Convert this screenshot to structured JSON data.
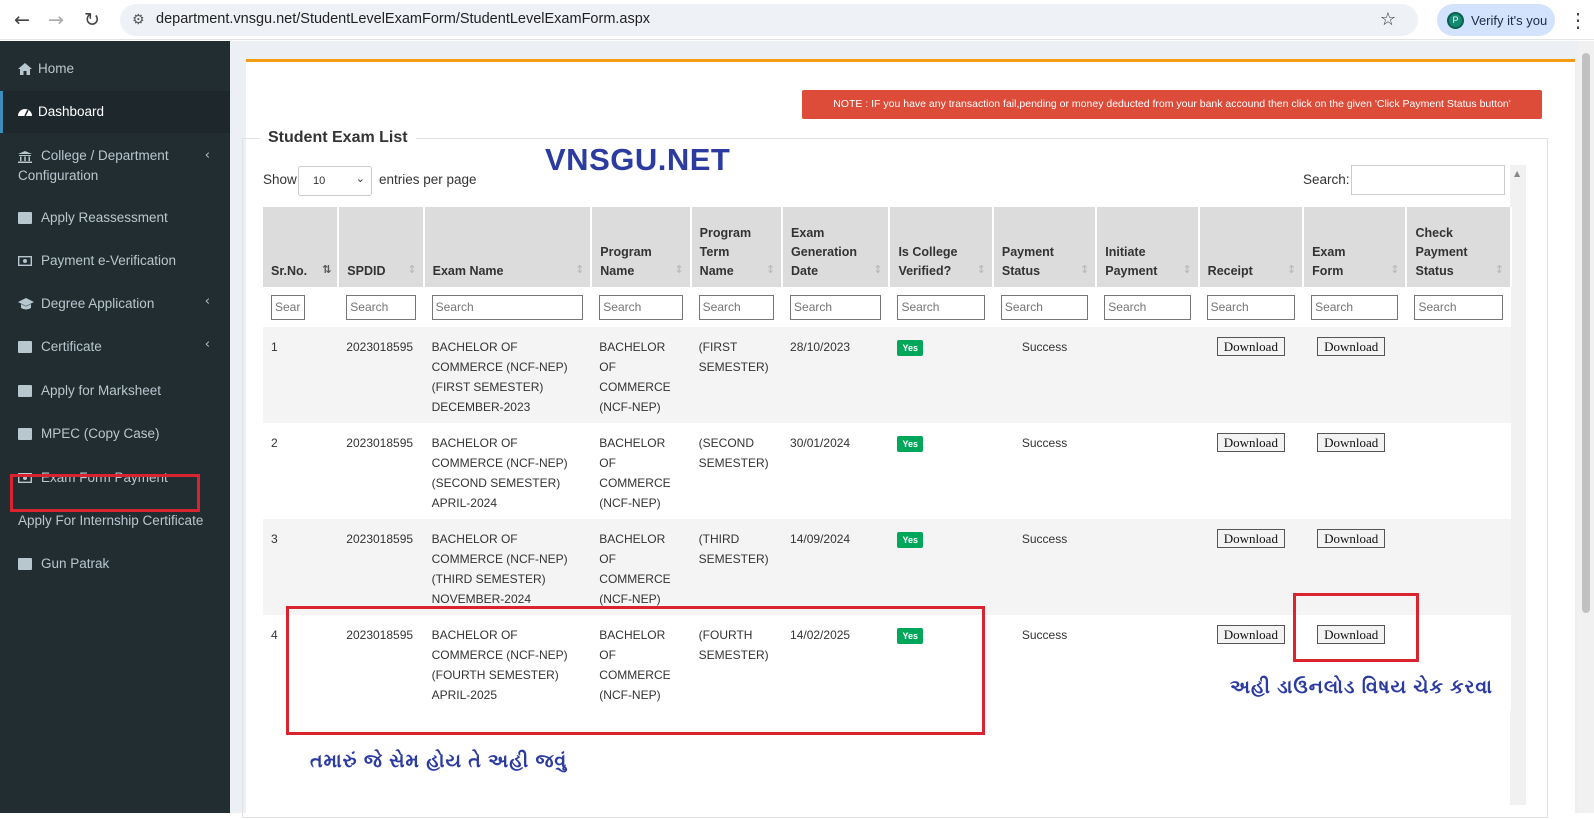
{
  "browser": {
    "url": "department.vnsgu.net/StudentLevelExamForm/StudentLevelExamForm.aspx",
    "profile_label": "Verify it's you",
    "profile_initial": "P"
  },
  "sidebar": {
    "items": [
      {
        "label": "Home",
        "icon": "home-icon"
      },
      {
        "label": "Dashboard",
        "icon": "dashboard-icon"
      },
      {
        "label": "College / Department",
        "label2": "Configuration",
        "icon": "institution-icon"
      },
      {
        "label": "Apply Reassessment",
        "icon": "book-icon"
      },
      {
        "label": "Payment e-Verification",
        "icon": "money-icon"
      },
      {
        "label": "Degree Application",
        "icon": "graduation-cap-icon"
      },
      {
        "label": "Certificate",
        "icon": "book-icon"
      },
      {
        "label": "Apply for Marksheet",
        "icon": "book-icon"
      },
      {
        "label": "MPEC (Copy Case)",
        "icon": "book-icon"
      },
      {
        "label": "Exam Form Payment",
        "icon": "money-icon"
      },
      {
        "label": "Apply For Internship Certificate",
        "icon": ""
      },
      {
        "label": "Gun Patrak",
        "icon": "book-icon"
      }
    ]
  },
  "note": "NOTE : IF you have any transaction fail,pending or money deducted from your bank accound then click on the given 'Click Payment Status button'",
  "section_title": "Student Exam List",
  "watermark": "VNSGU.NET",
  "table_controls": {
    "show_label": "Show",
    "entries_value": "10",
    "entries_label": "entries per page",
    "search_label": "Search:"
  },
  "columns": [
    {
      "l1": "",
      "l2": "",
      "l3": "Sr.No."
    },
    {
      "l1": "",
      "l2": "",
      "l3": "SPDID"
    },
    {
      "l1": "",
      "l2": "",
      "l3": "Exam Name"
    },
    {
      "l1": "",
      "l2": "Program",
      "l3": "Name"
    },
    {
      "l1": "Program",
      "l2": "Term",
      "l3": "Name"
    },
    {
      "l1": "Exam",
      "l2": "Generation",
      "l3": "Date"
    },
    {
      "l1": "",
      "l2": "Is College",
      "l3": "Verified?"
    },
    {
      "l1": "",
      "l2": "Payment",
      "l3": "Status"
    },
    {
      "l1": "",
      "l2": "Initiate",
      "l3": "Payment"
    },
    {
      "l1": "",
      "l2": "",
      "l3": "Receipt"
    },
    {
      "l1": "",
      "l2": "Exam",
      "l3": "Form"
    },
    {
      "l1": "Check",
      "l2": "Payment",
      "l3": "Status"
    }
  ],
  "filter_placeholders": [
    "Sear",
    "Search",
    "Search",
    "Search",
    "Search",
    "Search",
    "Search",
    "Search",
    "Search",
    "Search",
    "Search",
    "Search"
  ],
  "rows": [
    {
      "sr": "1",
      "spdid": "2023018595",
      "exam": [
        "BACHELOR OF",
        "COMMERCE (NCF-NEP)",
        "(FIRST SEMESTER)",
        "DECEMBER-2023"
      ],
      "program": [
        "BACHELOR OF",
        "COMMERCE",
        "(NCF-NEP)"
      ],
      "term": [
        "(FIRST",
        "SEMESTER)"
      ],
      "date": "28/10/2023",
      "verified": "Yes",
      "status": "Success",
      "receipt": "Download",
      "form": "Download"
    },
    {
      "sr": "2",
      "spdid": "2023018595",
      "exam": [
        "BACHELOR OF",
        "COMMERCE (NCF-NEP)",
        "(SECOND SEMESTER)",
        "APRIL-2024"
      ],
      "program": [
        "BACHELOR OF",
        "COMMERCE",
        "(NCF-NEP)"
      ],
      "term": [
        "(SECOND",
        "SEMESTER)"
      ],
      "date": "30/01/2024",
      "verified": "Yes",
      "status": "Success",
      "receipt": "Download",
      "form": "Download"
    },
    {
      "sr": "3",
      "spdid": "2023018595",
      "exam": [
        "BACHELOR OF",
        "COMMERCE (NCF-NEP)",
        "(THIRD SEMESTER)",
        "NOVEMBER-2024"
      ],
      "program": [
        "BACHELOR OF",
        "COMMERCE",
        "(NCF-NEP)"
      ],
      "term": [
        "(THIRD",
        "SEMESTER)"
      ],
      "date": "14/09/2024",
      "verified": "Yes",
      "status": "Success",
      "receipt": "Download",
      "form": "Download"
    },
    {
      "sr": "4",
      "spdid": "2023018595",
      "exam": [
        "BACHELOR OF",
        "COMMERCE (NCF-NEP)",
        "(FOURTH SEMESTER)",
        "APRIL-2025"
      ],
      "program": [
        "BACHELOR OF",
        "COMMERCE",
        "(NCF-NEP)"
      ],
      "term": [
        "(FOURTH",
        "SEMESTER)"
      ],
      "date": "14/02/2025",
      "verified": "Yes",
      "status": "Success",
      "receipt": "Download",
      "form": "Download"
    }
  ],
  "annotations": {
    "download_hint": "અહી ડાઉનલોડ વિષય ચેક કરવા",
    "row_hint": "તમારું જે સેમ હોય તે અહી જવું"
  },
  "colors": {
    "sidebar_bg": "#222d32",
    "highlight_red": "#d9232e",
    "note_bg": "#dd4b39",
    "box_accent": "#f39c12",
    "badge_green": "#00a65a",
    "annotation_blue": "#2b3ba0"
  }
}
